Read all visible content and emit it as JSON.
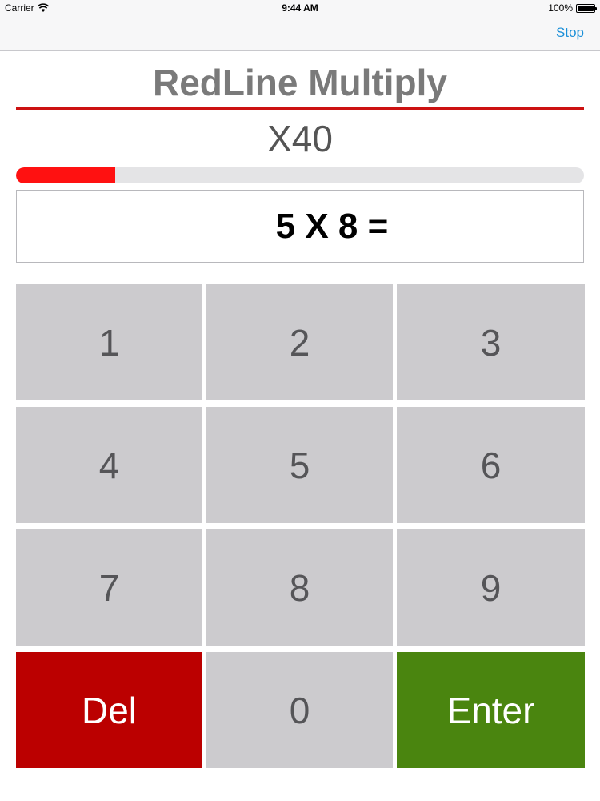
{
  "status_bar": {
    "carrier": "Carrier",
    "time": "9:44 AM",
    "battery": "100%"
  },
  "nav": {
    "stop_label": "Stop"
  },
  "app": {
    "title": "RedLine Multiply",
    "multiplier": "X40",
    "progress": 0.175,
    "question": "5 X 8 ="
  },
  "keypad": {
    "k1": "1",
    "k2": "2",
    "k3": "3",
    "k4": "4",
    "k5": "5",
    "k6": "6",
    "k7": "7",
    "k8": "8",
    "k9": "9",
    "del": "Del",
    "k0": "0",
    "enter": "Enter"
  },
  "colors": {
    "accent_red": "#cc1111",
    "progress_red": "#ff1111",
    "del_red": "#bb0000",
    "enter_green": "#4a850f",
    "key_gray": "#cccbce",
    "link_blue": "#1a8fd8"
  }
}
